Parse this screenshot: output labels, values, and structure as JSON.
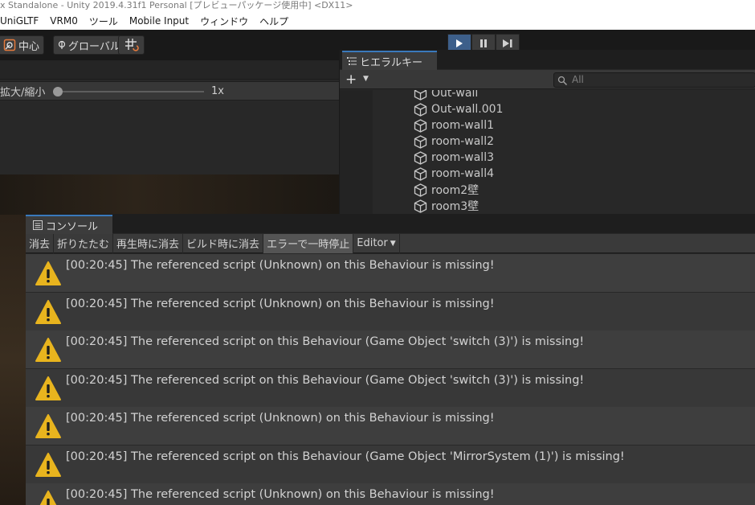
{
  "window": {
    "title": "x Standalone - Unity 2019.4.31f1 Personal [プレビューパッケージ使用中] <DX11>"
  },
  "menu": [
    "UniGLTF",
    "VRM0",
    "ツール",
    "Mobile Input",
    "ウィンドウ",
    "ヘルプ"
  ],
  "toolbar": {
    "pivot_label": "中心",
    "space_label": "グローバル",
    "play_icon": "play-icon",
    "pause_icon": "pause-icon",
    "step_icon": "step-icon"
  },
  "scene": {
    "zoom_label": "拡大/縮小",
    "zoom_value": "1x"
  },
  "hierarchy": {
    "tab_label": "ヒエラルキー",
    "add_label": "+",
    "search_placeholder": "All",
    "items": [
      "Out-wall",
      "Out-wall.001",
      "room-wall1",
      "room-wall2",
      "room-wall3",
      "room-wall4",
      "room2壁",
      "room3壁"
    ]
  },
  "console": {
    "tab_label": "コンソール",
    "buttons": [
      "消去",
      "折りたたむ",
      "再生時に消去",
      "ビルド時に消去",
      "エラーで一時停止",
      "Editor"
    ],
    "messages": [
      "[00:20:45] The referenced script (Unknown) on this Behaviour is missing!",
      "[00:20:45] The referenced script (Unknown) on this Behaviour is missing!",
      "[00:20:45] The referenced script on this Behaviour (Game Object 'switch (3)') is missing!",
      "[00:20:45] The referenced script on this Behaviour (Game Object 'switch (3)') is missing!",
      "[00:20:45] The referenced script (Unknown) on this Behaviour is missing!",
      "[00:20:45] The referenced script on this Behaviour (Game Object 'MirrorSystem (1)') is missing!",
      "[00:20:45] The referenced script (Unknown) on this Behaviour is missing!"
    ]
  },
  "colors": {
    "accent_tab": "#3a79bb",
    "warning": "#e8b41e",
    "play_active": "#3d5f8a",
    "annotation_mark": "#e61717"
  }
}
